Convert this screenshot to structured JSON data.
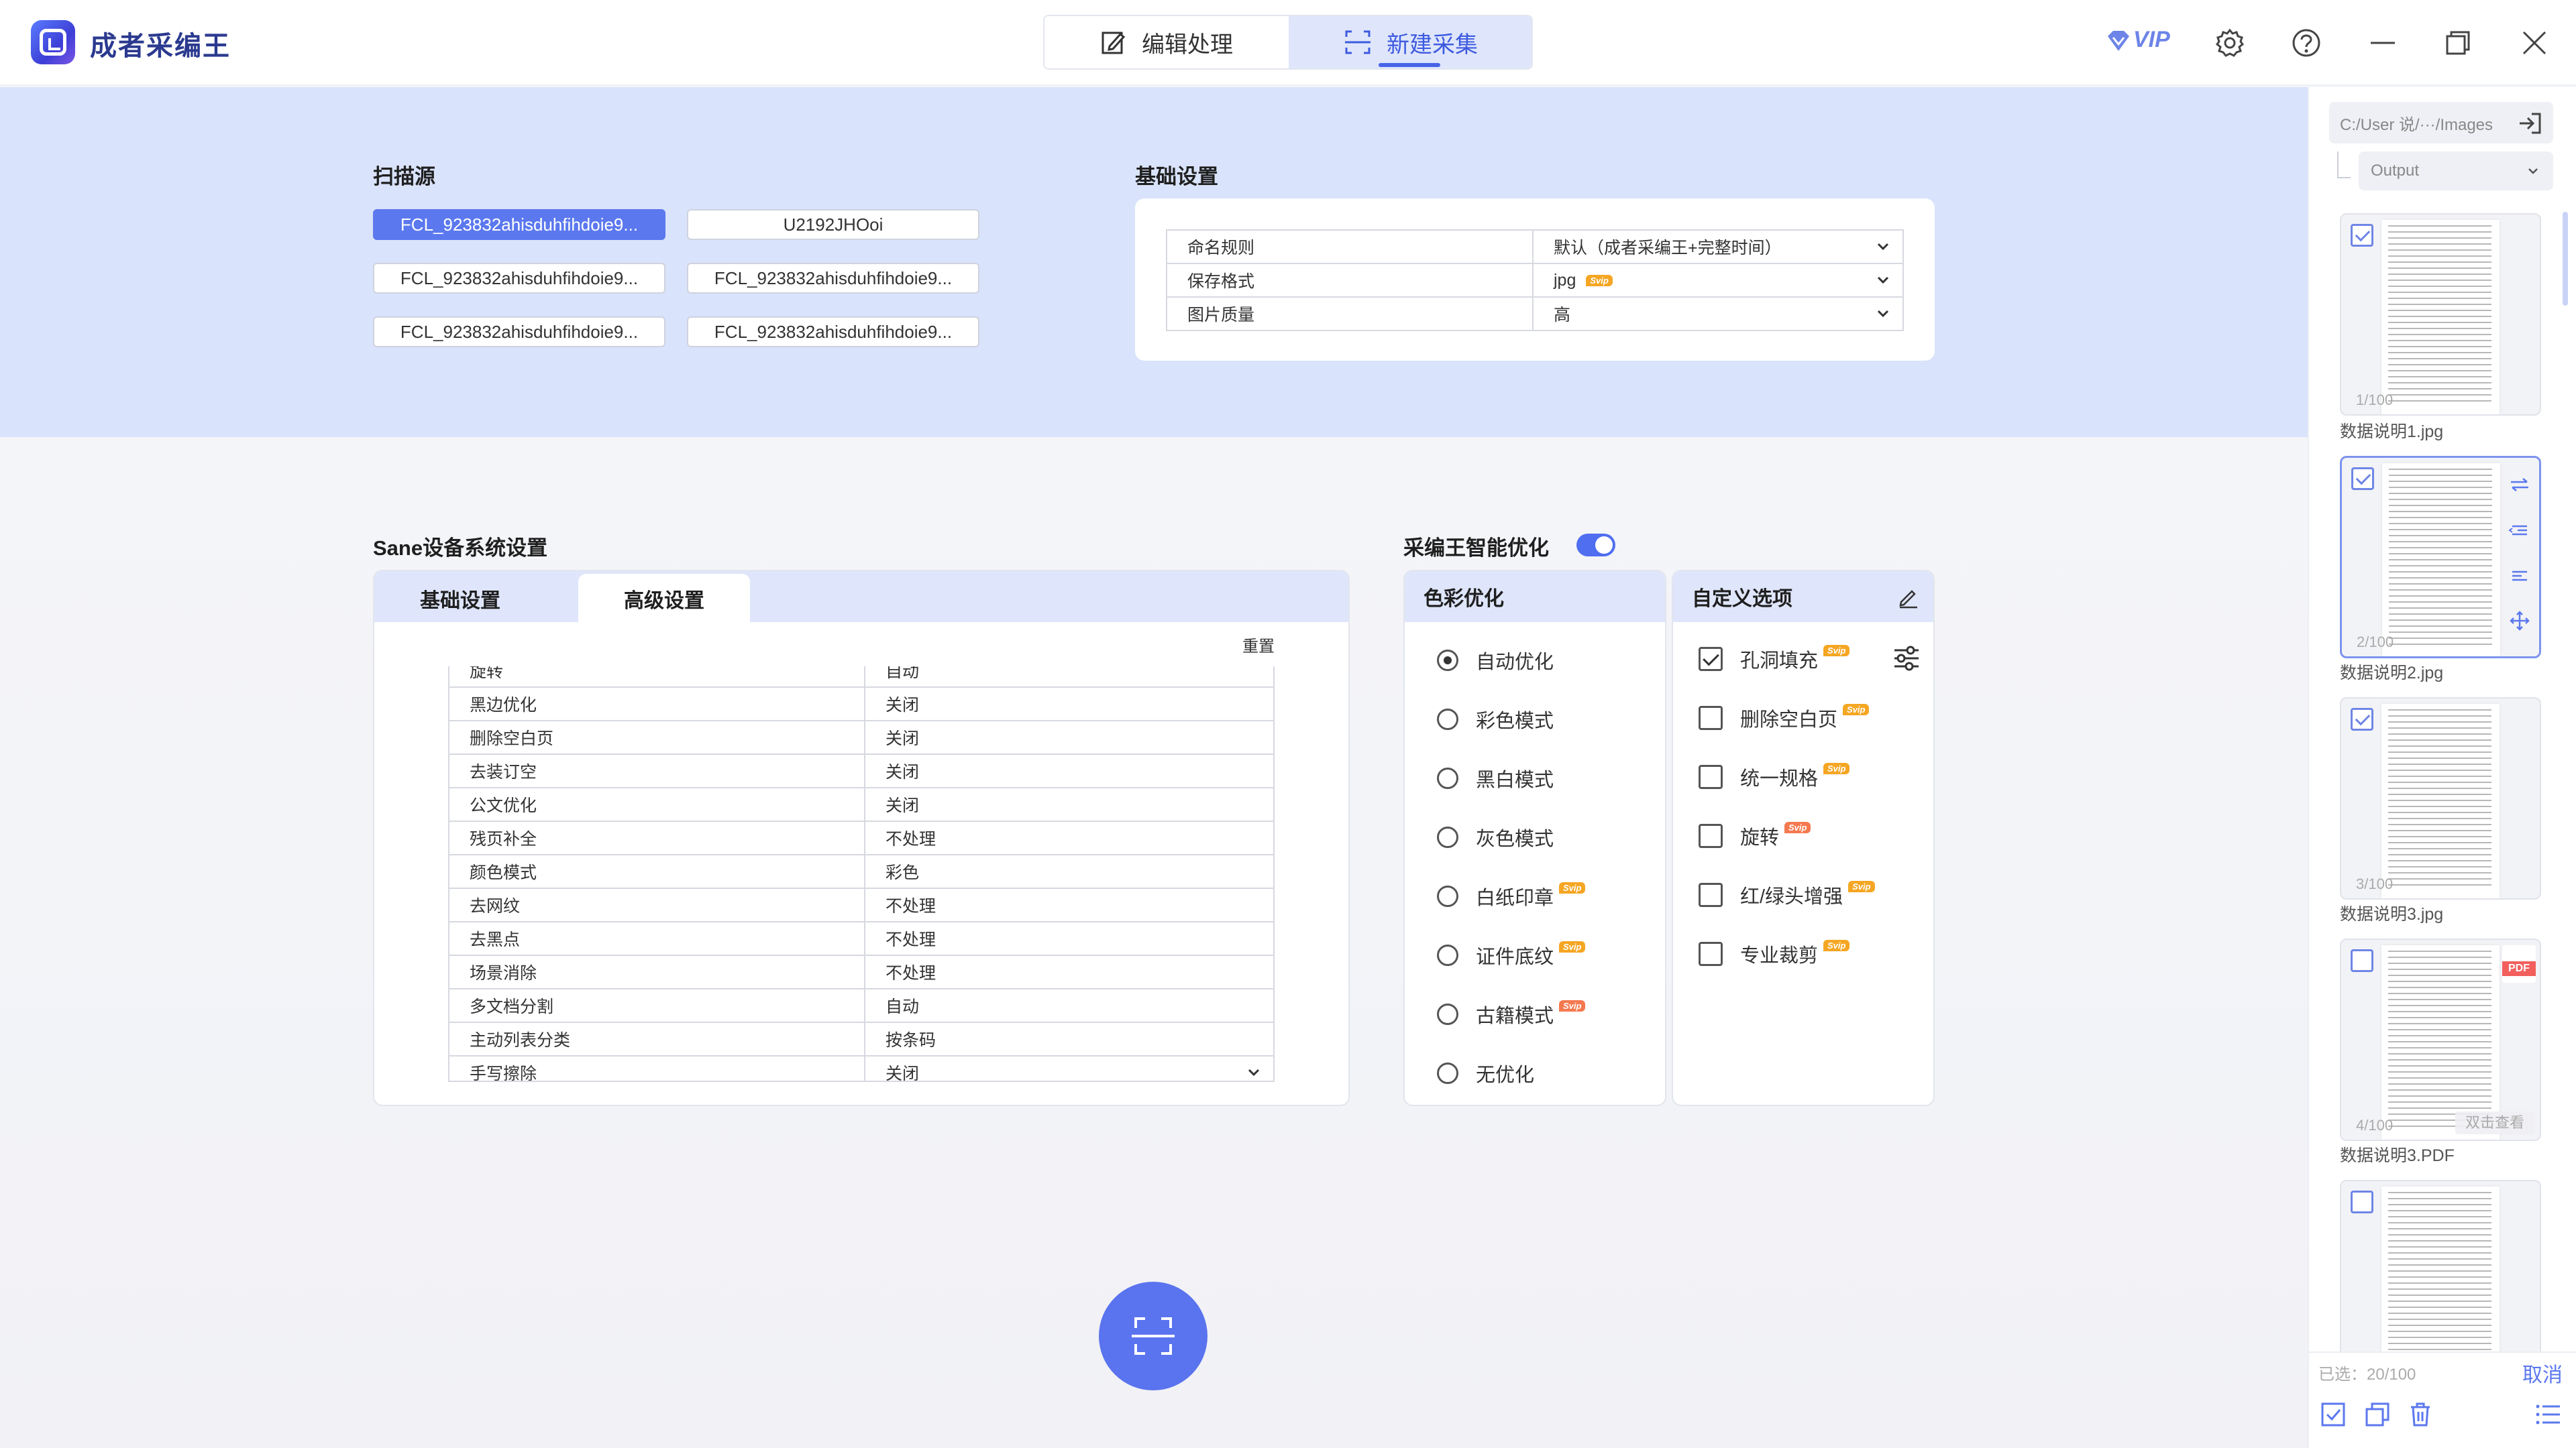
{
  "app": {
    "title": "成者采编王"
  },
  "mode_tabs": [
    {
      "label": "编辑处理"
    },
    {
      "label": "新建采集"
    }
  ],
  "titlebar": {
    "vip_label": "VIP"
  },
  "scan_source": {
    "title": "扫描源",
    "devices": [
      "FCL_923832ahisduhfihdoie9...",
      "U2192JHOoi",
      "FCL_923832ahisduhfihdoie9...",
      "FCL_923832ahisduhfihdoie9...",
      "FCL_923832ahisduhfihdoie9...",
      "FCL_923832ahisduhfihdoie9..."
    ]
  },
  "basic_settings": {
    "title": "基础设置",
    "rows": [
      {
        "label": "命名规则",
        "value": "默认（成者采编王+完整时间）",
        "badge": ""
      },
      {
        "label": "保存格式",
        "value": "jpg",
        "badge": "Svip"
      },
      {
        "label": "图片质量",
        "value": "高",
        "badge": ""
      }
    ]
  },
  "sane": {
    "title": "Sane设备系统设置",
    "tabs": [
      "基础设置",
      "高级设置"
    ],
    "reset_label": "重置",
    "rows": [
      {
        "label": "旋转",
        "value": "自动"
      },
      {
        "label": "黑边优化",
        "value": "关闭"
      },
      {
        "label": "删除空白页",
        "value": "关闭"
      },
      {
        "label": "去装订空",
        "value": "关闭"
      },
      {
        "label": "公文优化",
        "value": "关闭"
      },
      {
        "label": "残页补全",
        "value": "不处理"
      },
      {
        "label": "颜色模式",
        "value": "彩色"
      },
      {
        "label": "去网纹",
        "value": "不处理"
      },
      {
        "label": "去黑点",
        "value": "不处理"
      },
      {
        "label": "场景消除",
        "value": "不处理"
      },
      {
        "label": "多文档分割",
        "value": "自动"
      },
      {
        "label": "主动列表分类",
        "value": "按条码"
      },
      {
        "label": "手写擦除",
        "value": "关闭"
      }
    ]
  },
  "ai_opt": {
    "title": "采编王智能优化",
    "enabled": true,
    "color_opt": {
      "title": "色彩优化",
      "options": [
        {
          "label": "自动优化",
          "selected": true,
          "badge": ""
        },
        {
          "label": "彩色模式",
          "selected": false,
          "badge": ""
        },
        {
          "label": "黑白模式",
          "selected": false,
          "badge": ""
        },
        {
          "label": "灰色模式",
          "selected": false,
          "badge": ""
        },
        {
          "label": "白纸印章",
          "selected": false,
          "badge": "Svip"
        },
        {
          "label": "证件底纹",
          "selected": false,
          "badge": "Svip"
        },
        {
          "label": "古籍模式",
          "selected": false,
          "badge": "Svip"
        },
        {
          "label": "无优化",
          "selected": false,
          "badge": ""
        }
      ]
    },
    "custom": {
      "title": "自定义选项",
      "options": [
        {
          "label": "孔洞填充",
          "checked": true,
          "badge": "Svip"
        },
        {
          "label": "删除空白页",
          "checked": false,
          "badge": "Svip"
        },
        {
          "label": "统一规格",
          "checked": false,
          "badge": "Svip"
        },
        {
          "label": "旋转",
          "checked": false,
          "badge": "Svip"
        },
        {
          "label": "红/绿头增强",
          "checked": false,
          "badge": "Svip"
        },
        {
          "label": "专业裁剪",
          "checked": false,
          "badge": "Svip"
        }
      ]
    }
  },
  "sidebar": {
    "path": "C:/User 说/···/Images",
    "output_select": "Output",
    "thumbs": [
      {
        "num": "1/100",
        "name": "数据说明1.jpg",
        "checked": true
      },
      {
        "num": "2/100",
        "name": "数据说明2.jpg",
        "checked": true
      },
      {
        "num": "3/100",
        "name": "数据说明3.jpg",
        "checked": true
      },
      {
        "num": "4/100",
        "name": "数据说明3.PDF",
        "checked": false,
        "hint": "双击查看",
        "pdf": "PDF"
      },
      {
        "num": "",
        "name": "",
        "checked": false
      }
    ],
    "selected_count": "已选：20/100",
    "cancel_label": "取消"
  },
  "colors": {
    "accent": "#4f6ef0",
    "band": "#d9e3fb",
    "badge": "#f5a623"
  }
}
